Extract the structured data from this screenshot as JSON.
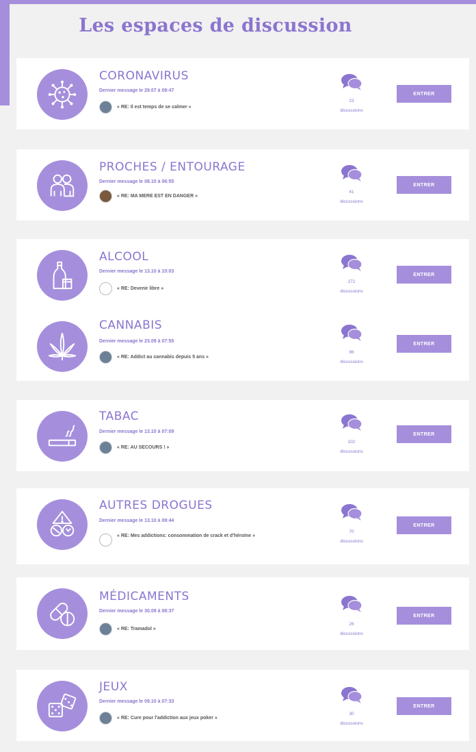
{
  "page": {
    "title": "Les espaces de discussion",
    "accent_color": "#a58fdc",
    "title_color": "#8b75cf"
  },
  "forums": [
    {
      "title": "CORONAVIRUS",
      "icon": "virus-icon",
      "last_message": "Dernier message le 29.07 à 09:47",
      "author_avatar": "photo",
      "preview": "« RE: Il est temps de se calmer »",
      "count": "23",
      "count_label": "discussions",
      "button": "ENTRER"
    },
    {
      "title": "PROCHES / ENTOURAGE",
      "icon": "people-icon",
      "last_message": "Dernier message le 08.10 à 06:55",
      "author_avatar": "photo",
      "preview": "« RE: MA MERE EST EN DANGER »",
      "count": "41",
      "count_label": "discussions",
      "button": "ENTRER"
    },
    {
      "title": "ALCOOL",
      "icon": "bottle-icon",
      "last_message": "Dernier message le 13.10 à 10:03",
      "author_avatar": "none",
      "preview": "« RE: Devenir libre »",
      "count": "272",
      "count_label": "discussions",
      "button": "ENTRER"
    },
    {
      "title": "CANNABIS",
      "icon": "cannabis-leaf-icon",
      "last_message": "Dernier message le 23.09 à 07:55",
      "author_avatar": "photo",
      "preview": "« RE: Addict au cannabis depuis 5 ans »",
      "count": "96",
      "count_label": "discussions",
      "button": "ENTRER"
    },
    {
      "title": "TABAC",
      "icon": "cigarette-icon",
      "last_message": "Dernier message le 13.10 à 07:09",
      "author_avatar": "photo",
      "preview": "« RE: AU SECOURS ! »",
      "count": "102",
      "count_label": "discussions",
      "button": "ENTRER"
    },
    {
      "title": "AUTRES DROGUES",
      "icon": "drugs-icon",
      "last_message": "Dernier message le 13.10 à 09:44",
      "author_avatar": "none",
      "preview": "« RE: Mes addictions: consommation de crack et d'héroïne »",
      "count": "70",
      "count_label": "discussions",
      "button": "ENTRER"
    },
    {
      "title": "MÉDICAMENTS",
      "icon": "pills-icon",
      "last_message": "Dernier message le 30.09 à 08:37",
      "author_avatar": "photo",
      "preview": "« RE: Tramadol »",
      "count": "26",
      "count_label": "discussions",
      "button": "ENTRER"
    },
    {
      "title": "JEUX",
      "icon": "dice-icon",
      "last_message": "Dernier message le 09.10 à 07:33",
      "author_avatar": "photo",
      "preview": "« RE: Cure pour l'addiction aux jeux poker »",
      "count": "30",
      "count_label": "discussions",
      "button": "ENTRER"
    }
  ]
}
